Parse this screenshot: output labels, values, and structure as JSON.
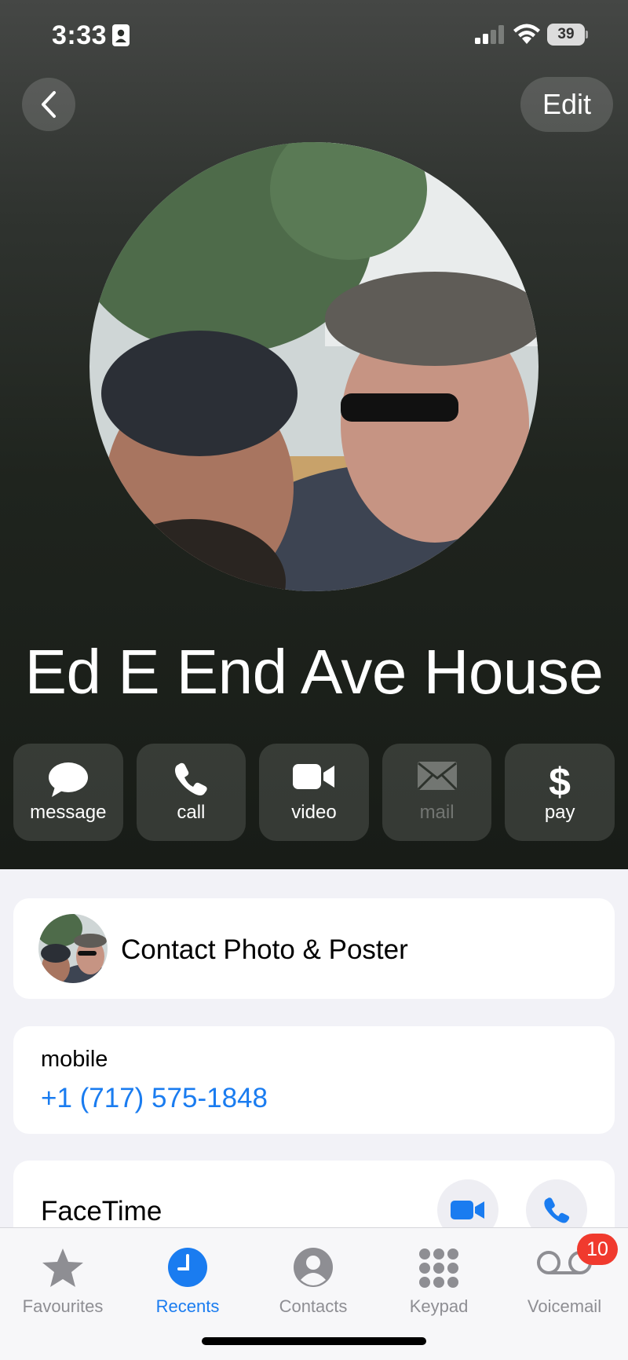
{
  "status_bar": {
    "time": "3:33",
    "battery": "39"
  },
  "nav": {
    "edit_label": "Edit"
  },
  "contact": {
    "name": "Ed E End Ave House"
  },
  "actions": [
    {
      "label": "message",
      "icon": "message-bubble-icon",
      "enabled": true
    },
    {
      "label": "call",
      "icon": "phone-icon",
      "enabled": true
    },
    {
      "label": "video",
      "icon": "video-camera-icon",
      "enabled": true
    },
    {
      "label": "mail",
      "icon": "envelope-icon",
      "enabled": false
    },
    {
      "label": "pay",
      "icon": "dollar-icon",
      "enabled": true
    }
  ],
  "photo_card": {
    "label": "Contact Photo & Poster"
  },
  "phone_card": {
    "type": "mobile",
    "number": "+1 (717) 575-1848"
  },
  "facetime_card": {
    "label": "FaceTime"
  },
  "tabbar": {
    "tabs": [
      {
        "label": "Favourites",
        "icon": "star-icon"
      },
      {
        "label": "Recents",
        "icon": "clock-icon",
        "active": true
      },
      {
        "label": "Contacts",
        "icon": "person-circle-icon"
      },
      {
        "label": "Keypad",
        "icon": "keypad-icon"
      },
      {
        "label": "Voicemail",
        "icon": "voicemail-icon"
      }
    ],
    "voicemail_badge": "10"
  },
  "colors": {
    "accent": "#1a7cf0",
    "badge": "#f03a2e"
  }
}
